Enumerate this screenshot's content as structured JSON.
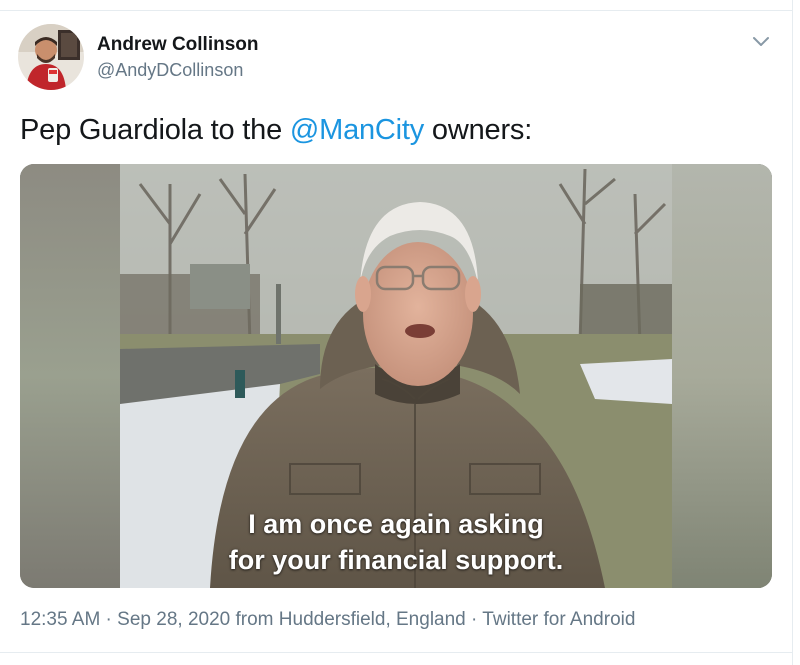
{
  "author": {
    "name": "Andrew Collinson",
    "handle": "@AndyDCollinson",
    "avatar_icon": "avatar-photo"
  },
  "menu": {
    "icon": "chevron-down-icon"
  },
  "tweet": {
    "text_before": "Pep Guardiola to the ",
    "mention": "@ManCity",
    "text_after": " owners:"
  },
  "media": {
    "caption_line1": "I am once again asking",
    "caption_line2": "for your financial support."
  },
  "meta": {
    "time": "12:35 AM",
    "separator1": " · ",
    "date": "Sep 28, 2020",
    "from_text": " from ",
    "location": "Huddersfield, England",
    "separator2": " · ",
    "client": "Twitter for Android"
  },
  "colors": {
    "link": "#1b95e0",
    "secondary_text": "#657786",
    "primary_text": "#14171a",
    "border": "#e6ecf0"
  }
}
